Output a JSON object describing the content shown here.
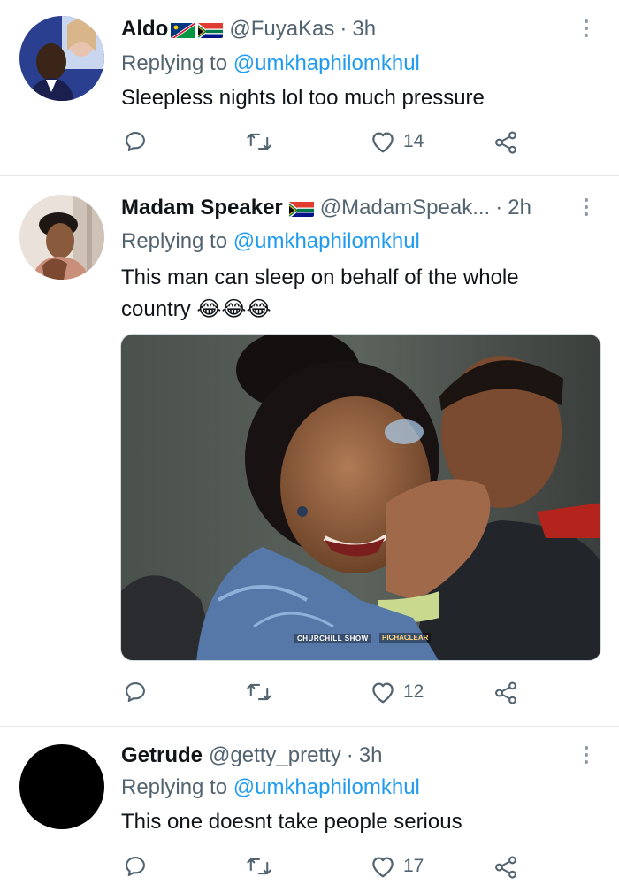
{
  "tweets": [
    {
      "name": "Aldo",
      "flags": [
        "namibia",
        "south-africa"
      ],
      "handle": "@FuyaKas",
      "separator": "·",
      "time": "3h",
      "replying_prefix": "Replying to",
      "replying_to": "@umkhaphilomkhul",
      "text": "Sleepless nights lol too much pressure",
      "likes": "14"
    },
    {
      "name": "Madam Speaker",
      "flags": [
        "south-africa"
      ],
      "handle": "@MadamSpeak...",
      "separator": "·",
      "time": "2h",
      "replying_prefix": "Replying to",
      "replying_to": "@umkhaphilomkhul",
      "text": "This man can sleep on behalf of the whole country 😂😂😂",
      "likes": "12",
      "media": {
        "description": "Woman laughing covering her mouth with her hand, man smiling behind her",
        "watermark_left": "CHURCHILL SHOW",
        "watermark_right": "PICHACLEAR",
        "watermark_right_url": "www.pichaclear.co.ke"
      }
    },
    {
      "name": "Getrude",
      "flags": [],
      "handle": "@getty_pretty",
      "separator": "·",
      "time": "3h",
      "replying_prefix": "Replying to",
      "replying_to": "@umkhaphilomkhul",
      "text": "This one doesnt take people serious",
      "likes": "17"
    }
  ],
  "icons": {
    "reply": "reply-icon",
    "retweet": "retweet-icon",
    "like": "heart-icon",
    "share": "share-icon",
    "more": "more-options-icon"
  },
  "colors": {
    "mention": "#1d9bf0",
    "secondary_text": "#536471",
    "divider": "#e4e8ec"
  }
}
